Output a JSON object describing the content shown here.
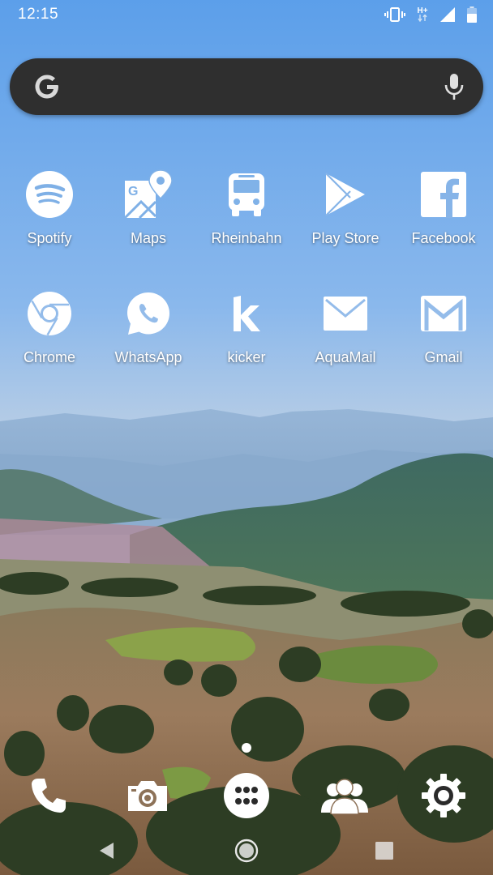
{
  "status_bar": {
    "time": "12:15",
    "network_type": "H+",
    "icons": [
      "vibrate-icon",
      "network-type-icon",
      "signal-icon",
      "battery-icon"
    ]
  },
  "search_bar": {
    "logo": "google-g-icon",
    "voice": "mic-icon"
  },
  "apps": [
    {
      "label": "Spotify",
      "icon": "spotify-icon"
    },
    {
      "label": "Maps",
      "icon": "maps-icon"
    },
    {
      "label": "Rheinbahn",
      "icon": "bus-icon"
    },
    {
      "label": "Play Store",
      "icon": "play-store-icon"
    },
    {
      "label": "Facebook",
      "icon": "facebook-icon"
    },
    {
      "label": "Chrome",
      "icon": "chrome-icon"
    },
    {
      "label": "WhatsApp",
      "icon": "whatsapp-icon"
    },
    {
      "label": "kicker",
      "icon": "kicker-icon"
    },
    {
      "label": "AquaMail",
      "icon": "mail-icon"
    },
    {
      "label": "Gmail",
      "icon": "gmail-icon"
    }
  ],
  "dock": [
    "phone-icon",
    "camera-icon",
    "app-drawer-icon",
    "contacts-icon",
    "settings-icon"
  ],
  "page_indicator": {
    "pages": 1,
    "current": 1
  },
  "nav_bar": [
    "back-icon",
    "home-icon",
    "recents-icon"
  ],
  "colors": {
    "icon": "#ffffff",
    "search_bar": "#2f2f2f",
    "sky_top": "#5fa2ec",
    "sky_bottom": "#a9c9ec"
  }
}
